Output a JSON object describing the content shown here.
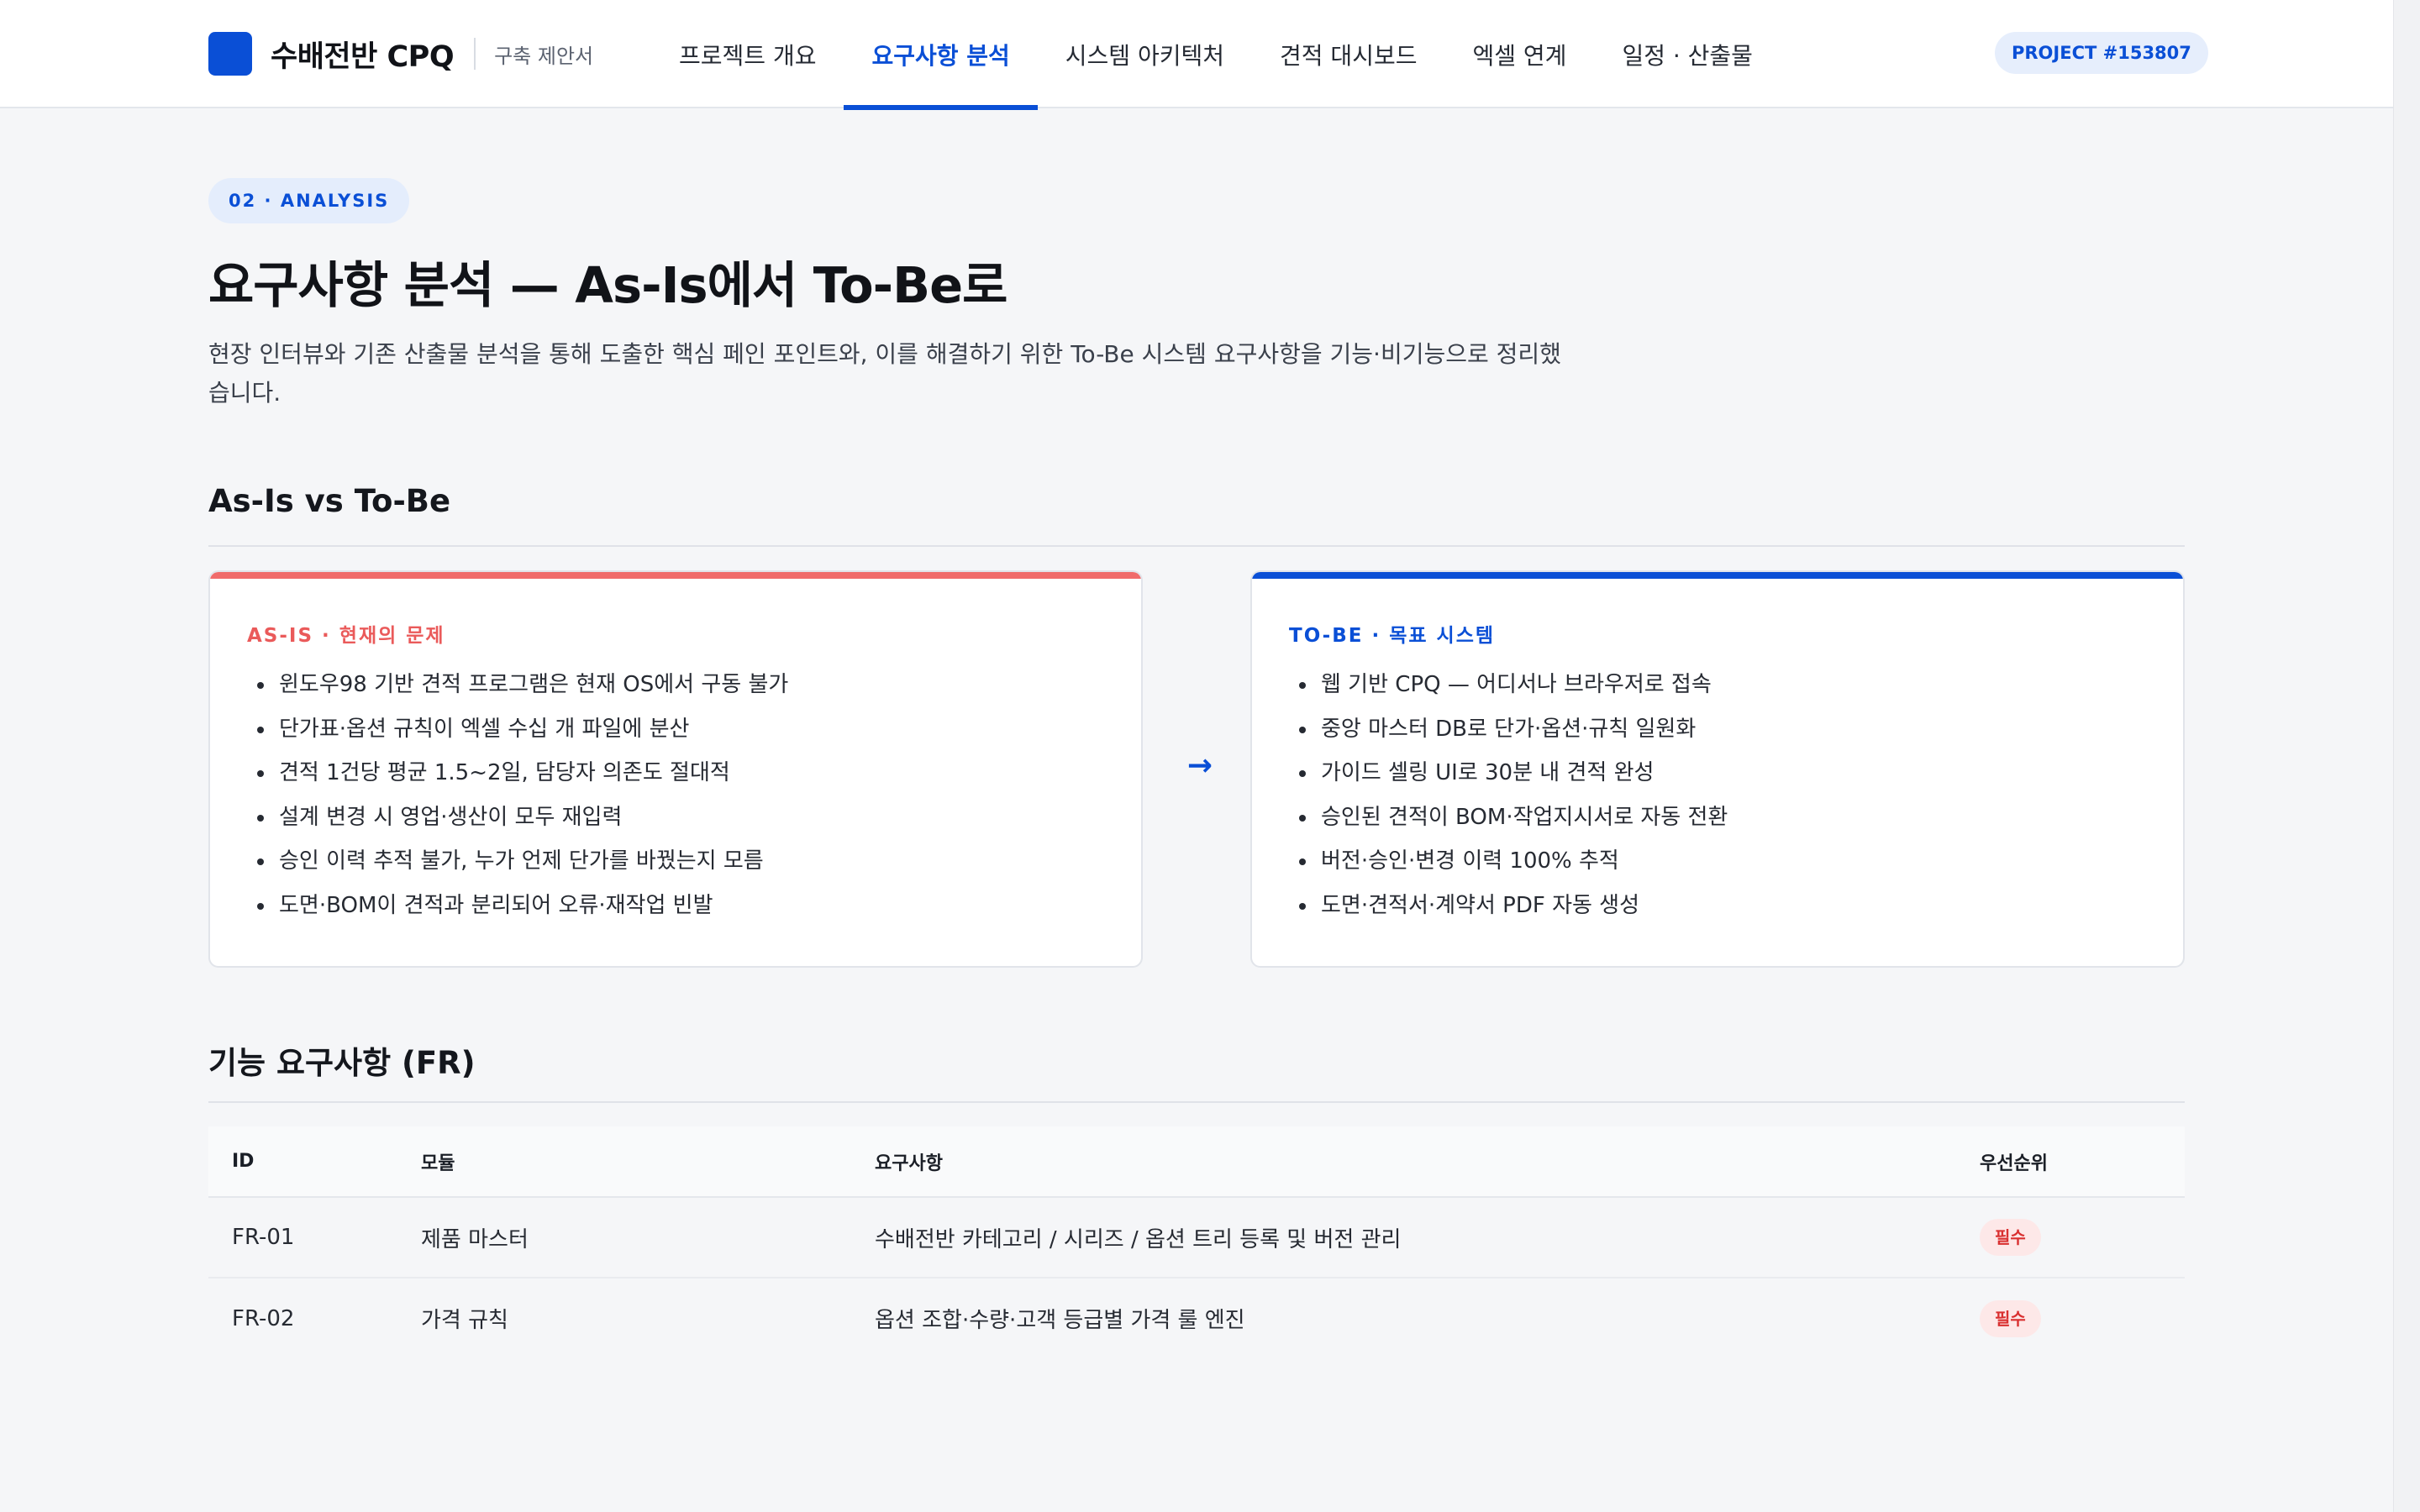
{
  "header": {
    "brand_name": "수배전반 CPQ",
    "brand_sub": "구축 제안서",
    "nav": [
      {
        "label": "프로젝트 개요",
        "active": false
      },
      {
        "label": "요구사항 분석",
        "active": true
      },
      {
        "label": "시스템 아키텍처",
        "active": false
      },
      {
        "label": "견적 대시보드",
        "active": false
      },
      {
        "label": "엑셀 연계",
        "active": false
      },
      {
        "label": "일정 · 산출물",
        "active": false
      }
    ],
    "project_badge": "PROJECT #153807"
  },
  "main": {
    "eyebrow": "02 · ANALYSIS",
    "title": "요구사항 분석 — As-Is에서 To-Be로",
    "description": "현장 인터뷰와 기존 산출물 분석을 통해 도출한 핵심 페인 포인트와, 이를 해결하기 위한 To-Be 시스템 요구사항을 기능·비기능으로 정리했습니다."
  },
  "comparison": {
    "section_title": "As-Is vs To-Be",
    "asis": {
      "label": "AS-IS · 현재의 문제",
      "items": [
        "윈도우98 기반 견적 프로그램은 현재 OS에서 구동 불가",
        "단가표·옵션 규칙이 엑셀 수십 개 파일에 분산",
        "견적 1건당 평균 1.5~2일, 담당자 의존도 절대적",
        "설계 변경 시 영업·생산이 모두 재입력",
        "승인 이력 추적 불가, 누가 언제 단가를 바꿨는지 모름",
        "도면·BOM이 견적과 분리되어 오류·재작업 빈발"
      ]
    },
    "arrow": "→",
    "tobe": {
      "label": "TO-BE · 목표 시스템",
      "items": [
        "웹 기반 CPQ — 어디서나 브라우저로 접속",
        "중앙 마스터 DB로 단가·옵션·규칙 일원화",
        "가이드 셀링 UI로 30분 내 견적 완성",
        "승인된 견적이 BOM·작업지시서로 자동 전환",
        "버전·승인·변경 이력 100% 추적",
        "도면·견적서·계약서 PDF 자동 생성"
      ]
    }
  },
  "requirements": {
    "section_title": "기능 요구사항 (FR)",
    "columns": [
      "ID",
      "모듈",
      "요구사항",
      "우선순위"
    ],
    "rows": [
      {
        "id": "FR-01",
        "module": "제품 마스터",
        "requirement": "수배전반 카테고리 / 시리즈 / 옵션 트리 등록 및 버전 관리",
        "priority": "필수"
      },
      {
        "id": "FR-02",
        "module": "가격 규칙",
        "requirement": "옵션 조합·수량·고객 등급별 가격 룰 엔진",
        "priority": "필수"
      }
    ]
  },
  "colors": {
    "accent": "#0a4fd6",
    "asis_accent": "#f06b6b",
    "priority_bg": "#fde8e8",
    "priority_text": "#d93030"
  }
}
